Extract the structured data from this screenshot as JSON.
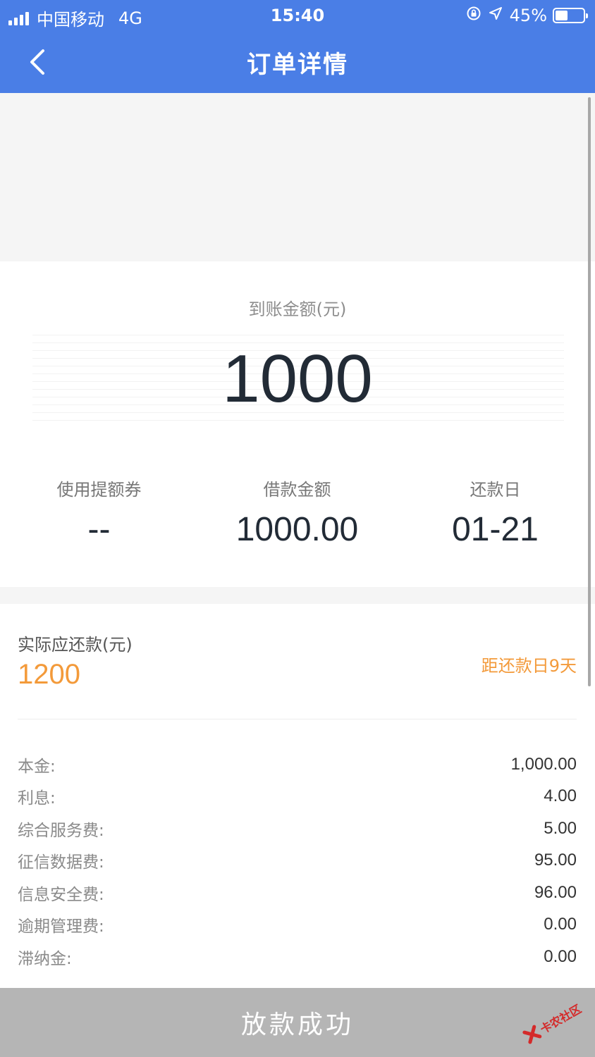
{
  "status_bar": {
    "carrier": "中国移动",
    "network": "4G",
    "time": "15:40",
    "battery": "45%",
    "battery_level": 0.45
  },
  "nav": {
    "title": "订单详情"
  },
  "arrival": {
    "label": "到账金额(元)",
    "amount": "1000"
  },
  "stats": [
    {
      "label": "使用提额券",
      "value": "--"
    },
    {
      "label": "借款金额",
      "value": "1000.00"
    },
    {
      "label": "还款日",
      "value": "01-21"
    }
  ],
  "repayment": {
    "label": "实际应还款(元)",
    "amount": "1200",
    "countdown": "距还款日9天"
  },
  "fees": [
    {
      "label": "本金:",
      "value": "1,000.00"
    },
    {
      "label": "利息:",
      "value": "4.00"
    },
    {
      "label": "综合服务费:",
      "value": "5.00"
    },
    {
      "label": "征信数据费:",
      "value": "95.00"
    },
    {
      "label": "信息安全费:",
      "value": "96.00"
    },
    {
      "label": "逾期管理费:",
      "value": "0.00"
    },
    {
      "label": "滞纳金:",
      "value": "0.00"
    }
  ],
  "bottom_button": {
    "label": "放款成功"
  },
  "watermark": {
    "text": "卡农社区"
  },
  "colors": {
    "header": "#4a7ee6",
    "accent_orange": "#f39a3a",
    "button_disabled": "#b5b5b5"
  },
  "icons": {
    "back": "chevron-left-icon",
    "rotation_lock": "rotation-lock-icon",
    "location": "location-arrow-icon",
    "battery": "battery-icon",
    "signal": "signal-bars-icon"
  }
}
